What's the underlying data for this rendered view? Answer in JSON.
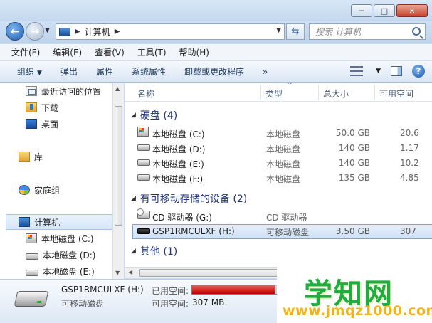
{
  "window": {
    "controls": [
      "─",
      "□",
      "✕"
    ]
  },
  "address": {
    "path": "计算机"
  },
  "search": {
    "placeholder": "搜索 计算机"
  },
  "menu": [
    "文件(F)",
    "编辑(E)",
    "查看(V)",
    "工具(T)",
    "帮助(H)"
  ],
  "toolbar": {
    "organize": "组织",
    "eject": "弹出",
    "properties": "属性",
    "system_properties": "系统属性",
    "uninstall": "卸载或更改程序",
    "more": "»"
  },
  "nav": {
    "recent": "最近访问的位置",
    "downloads": "下载",
    "desktop": "桌面",
    "libraries": "库",
    "homegroup": "家庭组",
    "computer": "计算机",
    "drives": [
      "本地磁盘 (C:)",
      "本地磁盘 (D:)",
      "本地磁盘 (E:)"
    ]
  },
  "columns": {
    "name": "名称",
    "type": "类型",
    "total": "总大小",
    "free": "可用空间"
  },
  "groups": {
    "hdd": "硬盘 (4)",
    "removable": "有可移动存储的设备 (2)",
    "other": "其他 (1)"
  },
  "hdd_rows": [
    {
      "name": "本地磁盘 (C:)",
      "type": "本地磁盘",
      "total": "50.0 GB",
      "free": "20.6"
    },
    {
      "name": "本地磁盘 (D:)",
      "type": "本地磁盘",
      "total": "140 GB",
      "free": "1.17"
    },
    {
      "name": "本地磁盘 (E:)",
      "type": "本地磁盘",
      "total": "140 GB",
      "free": "10.2"
    },
    {
      "name": "本地磁盘 (F:)",
      "type": "本地磁盘",
      "total": "135 GB",
      "free": "4.85"
    }
  ],
  "removable_rows": [
    {
      "name": "CD 驱动器 (G:)",
      "type": "CD 驱动器",
      "total": "",
      "free": ""
    },
    {
      "name": "GSP1RMCULXF (H:)",
      "type": "可移动磁盘",
      "total": "3.50 GB",
      "free": "307"
    }
  ],
  "details": {
    "name": "GSP1RMCULXF (H:)",
    "kind": "可移动磁盘",
    "used_label": "已用空间:",
    "free_label": "可用空间:",
    "free_value": "307 MB",
    "used_fraction": 0.91
  },
  "watermark": {
    "title": "学知网",
    "url": "www.jmqz1000.com"
  }
}
